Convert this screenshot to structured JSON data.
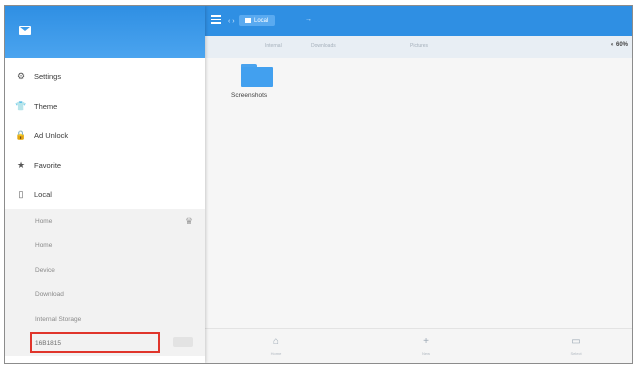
{
  "appbar": {
    "location_chip": "Local",
    "path_dots": "‹ ›",
    "arrow": "→"
  },
  "tabs": [
    "Internal",
    "Downloads",
    "Pictures"
  ],
  "storage_indicator": "60%",
  "menu": {
    "items": [
      {
        "label": "Settings",
        "icon": "gear-icon",
        "glyph": "⚙"
      },
      {
        "label": "Theme",
        "icon": "shirt-icon",
        "glyph": "👕"
      },
      {
        "label": "Ad Unlock",
        "icon": "lock-icon",
        "glyph": "🔒"
      },
      {
        "label": "Favorite",
        "icon": "star-icon",
        "glyph": "★"
      },
      {
        "label": "Local",
        "icon": "phone-icon",
        "glyph": "▯"
      }
    ]
  },
  "local_items": [
    {
      "label": "Home"
    },
    {
      "label": "Home"
    },
    {
      "label": "Device"
    },
    {
      "label": "Download"
    },
    {
      "label": "Internal Storage"
    },
    {
      "label": "16B1815"
    }
  ],
  "home_side_icon": "♛",
  "folder": {
    "name": "Screenshots"
  },
  "bottom_buttons": [
    {
      "glyph": "⌂",
      "label": "Home"
    },
    {
      "glyph": "+",
      "label": "New"
    },
    {
      "glyph": "▭",
      "label": "Select"
    }
  ],
  "colors": {
    "accent": "#2f8fe3",
    "folder": "#42a0ef",
    "highlight": "#e0352b"
  }
}
